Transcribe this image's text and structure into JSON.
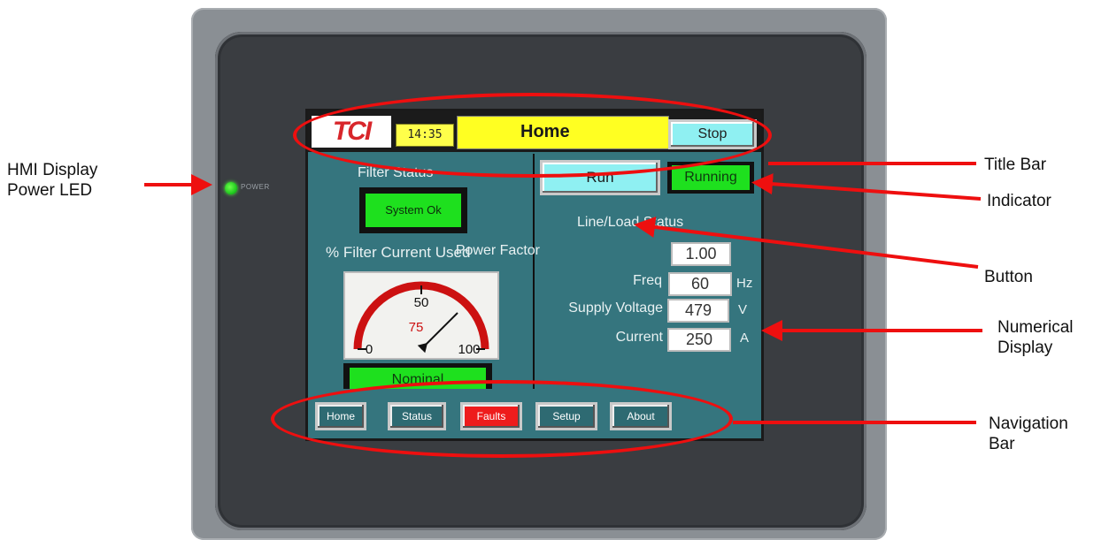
{
  "hmi": {
    "power_led_label": "POWER",
    "title_bar": {
      "logo_text": "TCI",
      "clock": "14:35",
      "page_title": "Home",
      "stop_label": "Stop"
    },
    "filter_status": {
      "label": "Filter Status",
      "indicator": "System Ok",
      "pct_label": "% Filter Current Used",
      "gauge": {
        "min_label": "0",
        "mid_label": "50",
        "max_label": "100",
        "value": 75,
        "value_label": "75"
      },
      "nominal": "Nominal"
    },
    "controls": {
      "run_label": "Run",
      "running_label": "Running"
    },
    "line_load": {
      "label": "Line/Load Status",
      "rows": [
        {
          "label": "Power Factor",
          "value": "1.00",
          "unit": ""
        },
        {
          "label": "Freq",
          "value": "60",
          "unit": "Hz"
        },
        {
          "label": "Supply Voltage",
          "value": "479",
          "unit": "V"
        },
        {
          "label": "Current",
          "value": "250",
          "unit": "A"
        }
      ]
    },
    "nav": [
      "Home",
      "Status",
      "Faults",
      "Setup",
      "About"
    ]
  },
  "callouts": {
    "hmi_power_led": "HMI Display Power LED",
    "title_bar": "Title Bar",
    "indicator": "Indicator",
    "button": "Button",
    "numerical_display": "Numerical Display",
    "navigation_bar": "Navigation Bar"
  },
  "colors": {
    "annotation_red": "#ee0f0f",
    "screen_teal": "#35757e",
    "indicator_green": "#1ee01e",
    "button_cyan": "#8ff0f2",
    "title_yellow": "#ffff22",
    "faults_red": "#ee1c1c"
  }
}
